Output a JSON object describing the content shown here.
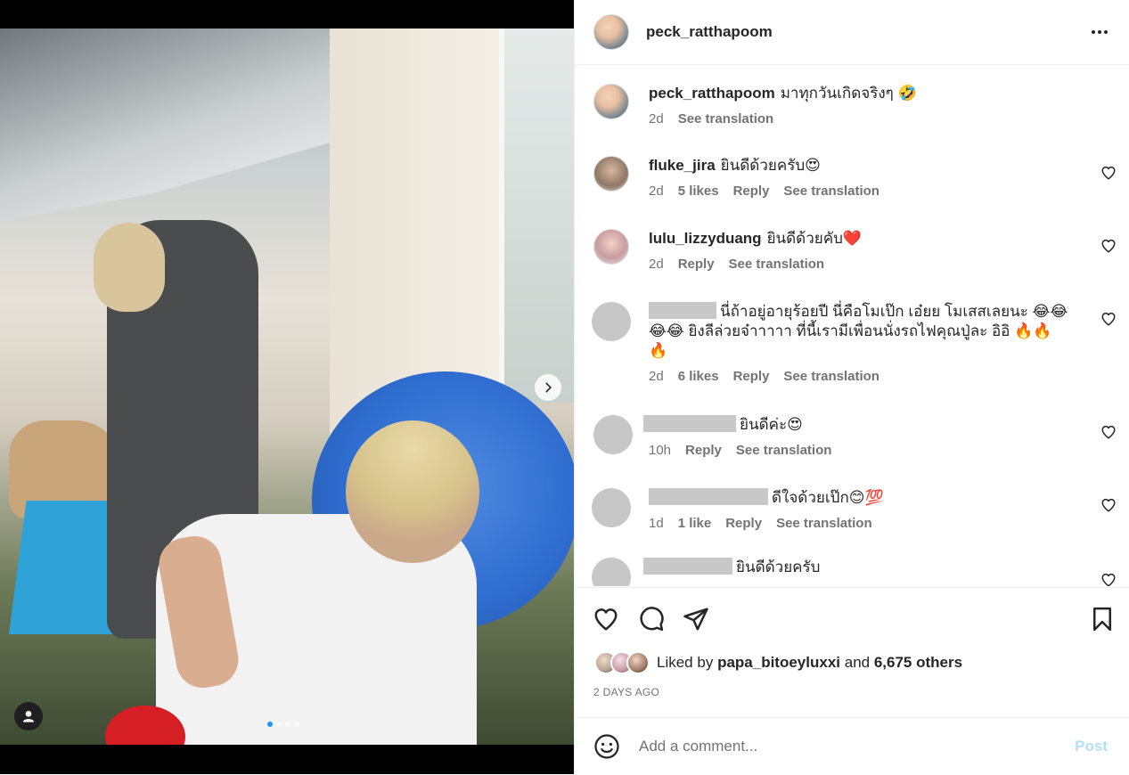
{
  "post": {
    "author": "peck_ratthapoom",
    "more_options_icon": "more-horizontal-icon",
    "carousel": {
      "slide_count": 4,
      "active_index": 0
    }
  },
  "caption": {
    "user": "peck_ratthapoom",
    "text": "มาทุกวันเกิดจริงๆ 🤣",
    "time": "2d",
    "see_translation": "See translation"
  },
  "comments": [
    {
      "user": "fluke_jira",
      "text": "ยินดีด้วยครับ😍",
      "time": "2d",
      "likes": "5 likes",
      "reply": "Reply",
      "see_translation": "See translation"
    },
    {
      "user": "lulu_lizzyduang",
      "text": "ยินดีด้วยคับ❤️",
      "time": "2d",
      "reply": "Reply",
      "see_translation": "See translation"
    },
    {
      "text_line1": "นี่ถ้าอยู่อายุร้อยปี นี่คือโมเป๊ก เอ๋ยย โมเสสเลยนะ 😂😂",
      "text_line2": "😂😂 ยิงลีล่วยจ๋าาาาา ที่นี้เรามีเพื่อนนั่งรถไฟคุณปู่ละ อิอิ 🔥🔥",
      "text_line3": "🔥",
      "time": "2d",
      "likes": "6 likes",
      "reply": "Reply",
      "see_translation": "See translation"
    },
    {
      "text": "ยินดีค่ะ😍",
      "time": "10h",
      "reply": "Reply",
      "see_translation": "See translation"
    },
    {
      "text": "ดีใจด้วยเป๊ก😊💯",
      "time": "1d",
      "likes": "1 like",
      "reply": "Reply",
      "see_translation": "See translation"
    },
    {
      "text": "ยินดีด้วยครับ"
    }
  ],
  "actions": {
    "like_icon": "heart-icon",
    "comment_icon": "comment-icon",
    "share_icon": "share-icon",
    "save_icon": "bookmark-icon"
  },
  "likes": {
    "prefix": "Liked by",
    "user": "papa_bitoeyluxxi",
    "middle": "and",
    "others": "6,675 others"
  },
  "date": "2 DAYS AGO",
  "add_comment": {
    "placeholder": "Add a comment...",
    "post_label": "Post",
    "post_color": "#b2dffc"
  }
}
